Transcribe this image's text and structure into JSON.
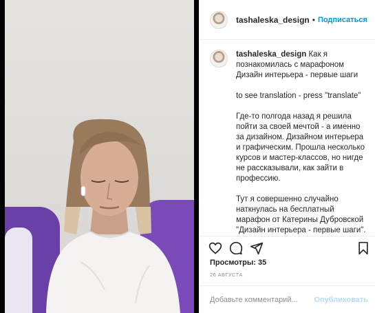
{
  "post": {
    "username": "tashaleska_design",
    "separator": "•",
    "follow_label": "Подписаться"
  },
  "caption": {
    "username": "tashaleska_design",
    "paragraphs": [
      "Как я познакомилась с марафоном Дизайн интерьера - первые шаги",
      "to see translation - press \"translate\"",
      "Где-то полгода назад я решила пойти за своей мечтой - а именно за дизайном. Дизайном интерьера и графическим. Прошла несколько курсов и мастер-классов, но нигде не рассказывали, как зайти в профессию.",
      "Тут я совершенно случайно наткнулась на бесплатный марафон от Катерины Дубровской \"Дизайн интерьера - первые шаги\". Вот оно, тут расскажут, как заходить в"
    ]
  },
  "stats": {
    "views": "Просмотры: 35",
    "date": "26 АВГУСТА"
  },
  "comment": {
    "placeholder": "Добавьте комментарий...",
    "publish_label": "Опубликовать"
  },
  "icons": {
    "like": "heart-icon",
    "comment": "comment-icon",
    "share": "share-icon",
    "save": "bookmark-icon"
  },
  "colors": {
    "accent": "#0095f6",
    "publish_disabled": "#b2dffc",
    "cushion": "#6a3fa8"
  }
}
